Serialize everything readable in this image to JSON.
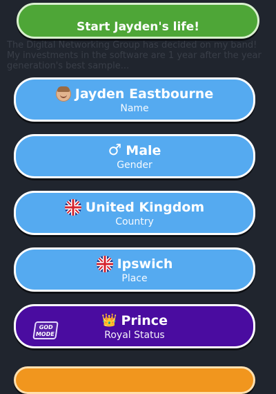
{
  "start_button": {
    "label": "Start Jayden's life!"
  },
  "background_log": [
    "The Digital Networking Group has decided on my band!",
    "My investments in the software are 1 year after the year",
    "generation's best sample..."
  ],
  "name": {
    "value": "Jayden Eastbourne",
    "label": "Name"
  },
  "gender": {
    "value": "Male",
    "label": "Gender",
    "icon_glyph": "♂"
  },
  "country": {
    "value": "United Kingdom",
    "label": "Country"
  },
  "place": {
    "value": "Ipswich",
    "label": "Place"
  },
  "royal": {
    "value": "Prince",
    "label": "Royal Status",
    "icon_glyph": "👑",
    "god_mode_badge": "GOD\nMODE"
  },
  "colors": {
    "green": "#4ea637",
    "blue": "#55aaf0",
    "purple": "#4a0ca0",
    "orange": "#f1961e",
    "background": "#20252e"
  }
}
